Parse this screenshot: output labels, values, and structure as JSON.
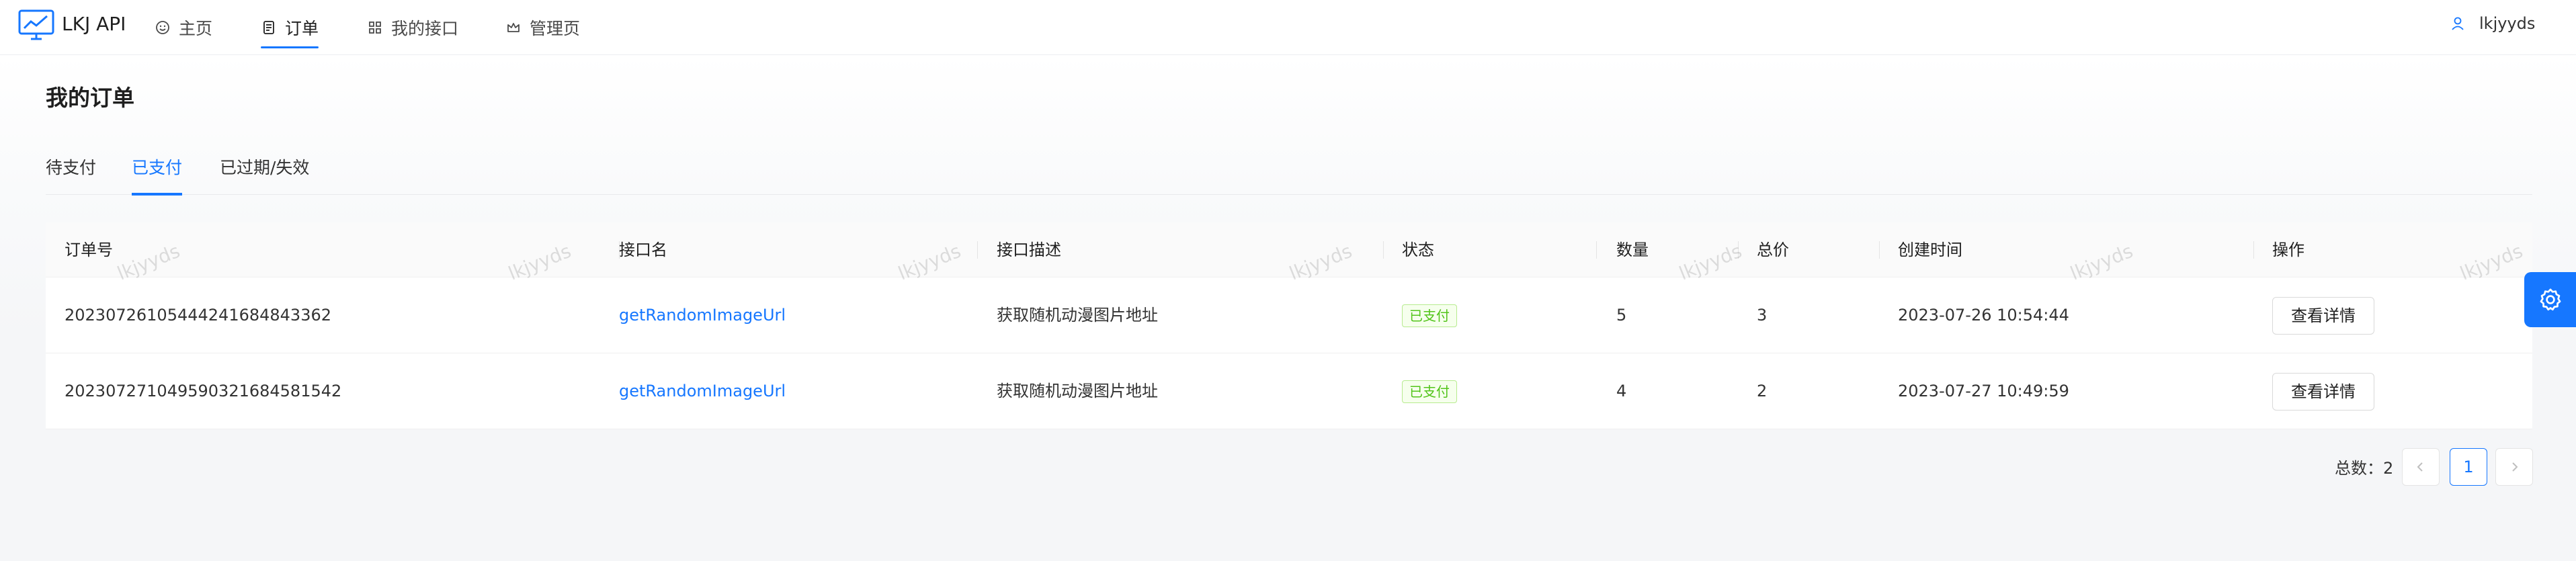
{
  "app": {
    "brand": "LKJ API"
  },
  "nav": {
    "items": [
      {
        "label": "主页",
        "icon": "smile-icon"
      },
      {
        "label": "订单",
        "icon": "order-icon"
      },
      {
        "label": "我的接口",
        "icon": "appstore-icon"
      },
      {
        "label": "管理页",
        "icon": "crown-icon"
      }
    ],
    "active_index": 1
  },
  "user": {
    "name": "lkjyyds",
    "icon": "user-icon"
  },
  "page": {
    "title": "我的订单"
  },
  "tabs": [
    {
      "label": "待支付"
    },
    {
      "label": "已支付"
    },
    {
      "label": "已过期/失效"
    }
  ],
  "active_tab": 1,
  "table": {
    "columns": [
      "订单号",
      "接口名",
      "接口描述",
      "状态",
      "数量",
      "总价",
      "创建时间",
      "操作"
    ],
    "rows": [
      {
        "order_no": "20230726105444241684843362",
        "api_name": "getRandomImageUrl",
        "description": "获取随机动漫图片地址",
        "status": "已支付",
        "quantity": "5",
        "total_price": "3",
        "created_at": "2023-07-26 10:54:44",
        "action": "查看详情"
      },
      {
        "order_no": "202307271049590321684581542",
        "api_name": "getRandomImageUrl",
        "description": "获取随机动漫图片地址",
        "status": "已支付",
        "quantity": "4",
        "total_price": "2",
        "created_at": "2023-07-27 10:49:59",
        "action": "查看详情"
      }
    ]
  },
  "watermark": "lkjyyds",
  "pagination": {
    "total_label": "总数：2",
    "current_page": "1",
    "prev_icon": "left-icon",
    "next_icon": "right-icon"
  },
  "colors": {
    "primary": "#1677ff",
    "success_text": "#52c41a",
    "success_bg": "#f6ffed"
  }
}
